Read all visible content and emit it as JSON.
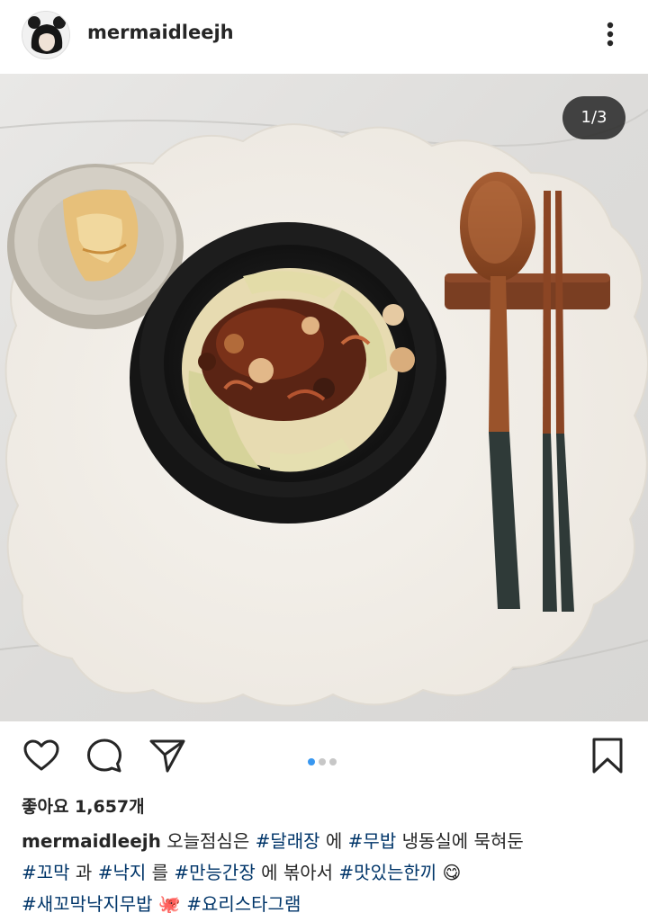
{
  "post": {
    "username": "mermaidleejh",
    "image_counter": "1/3",
    "likes_text": "좋아요 1,657개",
    "caption": {
      "segments": [
        {
          "text": "오늘점심은 ",
          "tag": false
        },
        {
          "text": "#달래장",
          "tag": true
        },
        {
          "text": " 에 ",
          "tag": false
        },
        {
          "text": "#무밥",
          "tag": true
        },
        {
          "text": " 냉동실에 묵혀둔 ",
          "tag": false
        },
        {
          "text": "#꼬막",
          "tag": true
        },
        {
          "text": " 과 ",
          "tag": false
        },
        {
          "text": "#낙지",
          "tag": true
        },
        {
          "text": " 를 ",
          "tag": false
        },
        {
          "text": "#만능간장",
          "tag": true
        },
        {
          "text": " 에 볶아서 ",
          "tag": false
        },
        {
          "text": "#맛있는한끼",
          "tag": true
        },
        {
          "text": " 😋 ",
          "tag": false
        },
        {
          "text": "#새꼬막낙지무밥",
          "tag": true
        },
        {
          "text": " 🐙 ",
          "tag": false
        },
        {
          "text": "#요리스타그램",
          "tag": true
        }
      ]
    },
    "carousel": {
      "total": 3,
      "active": 0
    }
  },
  "icons": {
    "more": "more-options-icon",
    "like": "heart-icon",
    "comment": "comment-icon",
    "share": "share-icon",
    "save": "bookmark-icon"
  },
  "colors": {
    "text": "#262626",
    "hashtag": "#003569",
    "active_dot": "#3897f0",
    "inactive_dot": "#c7c7c7"
  }
}
